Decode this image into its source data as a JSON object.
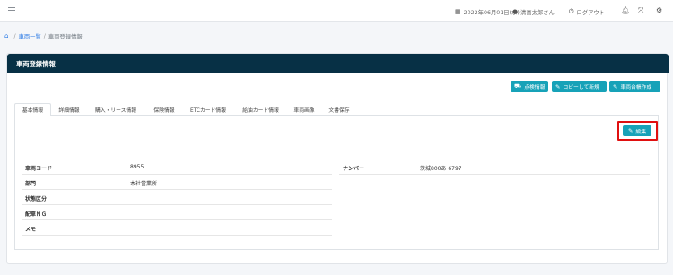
{
  "topbar": {
    "date": "2022年06月01日(水)",
    "user": "清喜太郎さん",
    "logout": "ログアウト",
    "icons": [
      "menu-icon",
      "calendar-icon",
      "user-icon",
      "power-icon",
      "bell-icon",
      "expand-icon",
      "settings-icon"
    ]
  },
  "breadcrumb": {
    "link": "車両一覧",
    "current": "車両登録情報"
  },
  "card": {
    "title": "車両登録情報",
    "header_color": "#073045"
  },
  "actions": {
    "inspection": "点検情報",
    "copy_new": "コピーして新規",
    "ledger": "車両台帳作成"
  },
  "tabs": [
    "基本情報",
    "詳細情報",
    "購入・リース情報",
    "保険情報",
    "ETCカード情報",
    "給油カード情報",
    "車両画像",
    "文書保存"
  ],
  "active_tab": "基本情報",
  "edit_label": "編集",
  "fields_left": [
    {
      "label": "車両コード",
      "value": "8955"
    },
    {
      "label": "部門",
      "value": "本社営業所"
    },
    {
      "label": "状態区分",
      "value": ""
    },
    {
      "label": "配車ＮＧ",
      "value": ""
    },
    {
      "label": "メモ",
      "value": ""
    }
  ],
  "fields_right": [
    {
      "label": "ナンバー",
      "value": "茨城800あ 6797"
    }
  ],
  "colors": {
    "accent": "#17a2b8",
    "link": "#2c7be5",
    "highlight": "#e01010"
  }
}
